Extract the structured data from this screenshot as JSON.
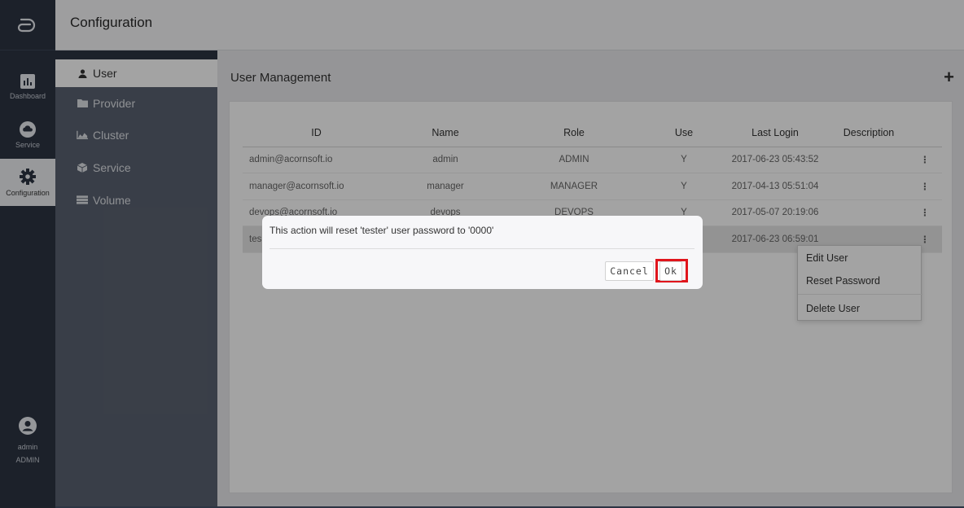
{
  "app": {
    "header_title": "Configuration"
  },
  "rail": {
    "items": [
      {
        "label": "Dashboard",
        "icon": "bar-chart-icon"
      },
      {
        "label": "Service",
        "icon": "cloud-icon"
      },
      {
        "label": "Configuration",
        "icon": "gear-icon"
      }
    ],
    "user": {
      "name": "admin",
      "role": "ADMIN"
    }
  },
  "submenu": {
    "items": [
      {
        "label": "User",
        "icon": "user-icon"
      },
      {
        "label": "Provider",
        "icon": "folder-icon"
      },
      {
        "label": "Cluster",
        "icon": "area-chart-icon"
      },
      {
        "label": "Service",
        "icon": "cube-icon"
      },
      {
        "label": "Volume",
        "icon": "drive-icon"
      }
    ]
  },
  "main": {
    "title": "User Management",
    "add_symbol": "+",
    "table": {
      "headers": [
        "ID",
        "Name",
        "Role",
        "Use",
        "Last Login",
        "Description"
      ],
      "rows": [
        {
          "id": "admin@acornsoft.io",
          "name": "admin",
          "role": "ADMIN",
          "use": "Y",
          "last_login": "2017-06-23 05:43:52"
        },
        {
          "id": "manager@acornsoft.io",
          "name": "manager",
          "role": "MANAGER",
          "use": "Y",
          "last_login": "2017-04-13 05:51:04"
        },
        {
          "id": "devops@acornsoft.io",
          "name": "devops",
          "role": "DEVOPS",
          "use": "Y",
          "last_login": "2017-05-07 20:19:06"
        },
        {
          "id": "tes",
          "name": "",
          "role": "",
          "use": "",
          "last_login": "2017-06-23 06:59:01"
        }
      ],
      "kebab": "⋮"
    }
  },
  "context_menu": {
    "items": [
      "Edit User",
      "Reset Password",
      "Delete User"
    ]
  },
  "dialog": {
    "message": "This action will reset 'tester' user password to '0000'",
    "cancel_label": "Cancel",
    "ok_label": "Ok"
  },
  "colors": {
    "rail_bg": "#2c3443",
    "submenu_bg": "#5a6271",
    "highlight": "#e0151c"
  }
}
